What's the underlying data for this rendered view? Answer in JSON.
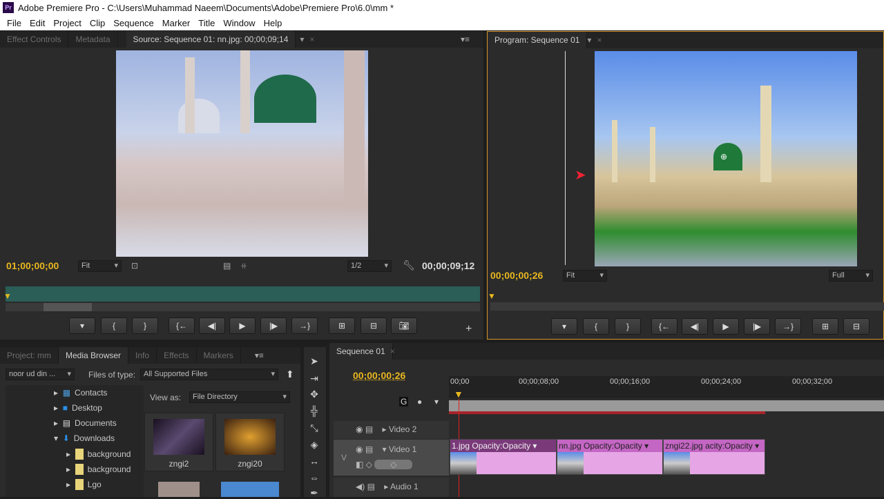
{
  "window": {
    "title": "Adobe Premiere Pro - C:\\Users\\Muhammad Naeem\\Documents\\Adobe\\Premiere Pro\\6.0\\mm *",
    "logo": "Pr"
  },
  "menu": [
    "File",
    "Edit",
    "Project",
    "Clip",
    "Sequence",
    "Marker",
    "Title",
    "Window",
    "Help"
  ],
  "source": {
    "tabs": [
      "Effect Controls",
      "Metadata",
      "Source: Sequence 01: nn.jpg: 00;00;09;14"
    ],
    "timecode_in": "01;00;00;00",
    "zoom": "Fit",
    "resolution": "1/2",
    "timecode_dur": "00;00;09;12"
  },
  "program": {
    "tab": "Program: Sequence 01",
    "timecode": "00;00;00;26",
    "zoom": "Fit",
    "resolution": "Full"
  },
  "project": {
    "tabs": [
      "Project: mm",
      "Media Browser",
      "Info",
      "Effects",
      "Markers"
    ],
    "location": "noor ud din ...",
    "files_of_type_label": "Files of type:",
    "files_of_type": "All Supported Files",
    "view_as_label": "View as:",
    "view_as": "File Directory",
    "tree": [
      "Contacts",
      "Desktop",
      "Documents",
      "Downloads",
      "background",
      "background",
      "Lgo"
    ],
    "thumbs": [
      "zngi2",
      "zngi20"
    ]
  },
  "timeline": {
    "tab": "Sequence 01",
    "timecode": "00;00;00;26",
    "ruler": [
      "00;00",
      "00;00;08;00",
      "00;00;16;00",
      "00;00;24;00",
      "00;00;32;00"
    ],
    "tracks": [
      "Video 2",
      "Video 1",
      "Audio 1"
    ],
    "target": "V",
    "clips": [
      {
        "name": "1.jpg",
        "fx": "Opacity:Opacity"
      },
      {
        "name": "nn.jpg",
        "fx": "Opacity:Opacity"
      },
      {
        "name": "zngi22.jpg",
        "fx": "acity:Opacity"
      }
    ]
  },
  "colors": {
    "timecode": "#e8b720",
    "accent": "#e8a23a",
    "clip": "#e6a6e6"
  }
}
